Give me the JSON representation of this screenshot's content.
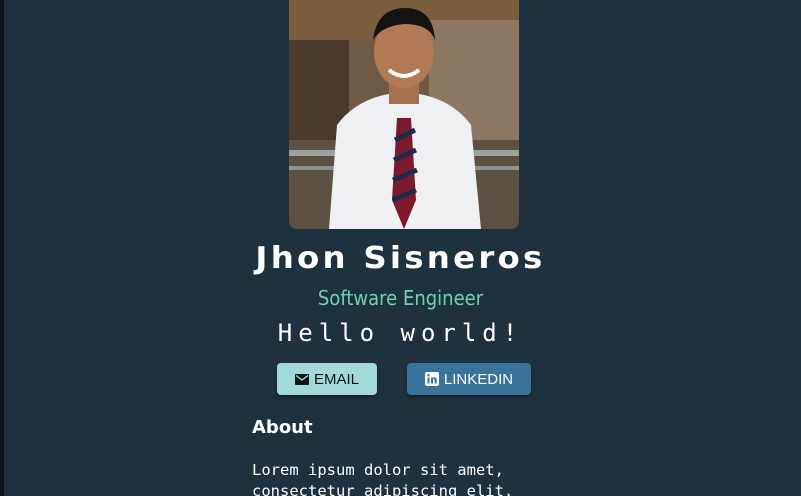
{
  "profile": {
    "name": "Jhon Sisneros",
    "title": "Software Engineer",
    "greeting": "Hello world!"
  },
  "buttons": {
    "email_label": "EMAIL",
    "email_icon": "mail-icon",
    "linkedin_label": "LINKEDIN",
    "linkedin_icon": "linkedin-icon"
  },
  "about": {
    "heading": "About",
    "body": "Lorem ipsum dolor sit amet, consectetur adipiscing elit."
  },
  "colors": {
    "background": "#1e313e",
    "accent_green": "#70d1a9",
    "email_button": "#a4d9dc",
    "linkedin_button": "#3a7399"
  }
}
